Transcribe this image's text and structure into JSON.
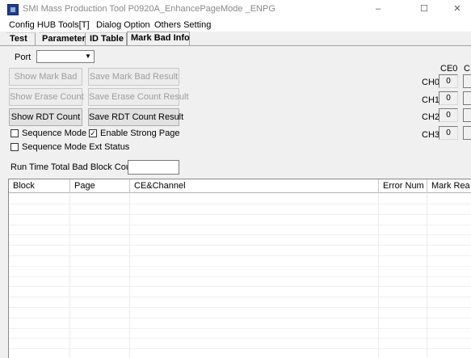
{
  "window": {
    "title": "SMI Mass Production Tool P0920A_EnhancePageMode       _ENPG",
    "minimize": "–",
    "maximize": "☐",
    "close": "✕"
  },
  "menubar": {
    "items": [
      "Config HUB",
      "Tools[T]",
      "Dialog Option",
      "Others Setting"
    ]
  },
  "tabs": [
    "Test",
    "Parameter",
    "ID Table",
    "Mark Bad Info"
  ],
  "active_tab": "Mark Bad Info",
  "port": {
    "label": "Port",
    "value": ""
  },
  "buttons": {
    "show_mark_bad": "Show Mark Bad",
    "save_mark_bad": "Save Mark Bad Result",
    "show_erase": "Show Erase Count",
    "save_erase": "Save Erase Count Result",
    "show_rdt": "Show RDT Count",
    "save_rdt": "Save RDT Count Result"
  },
  "checkboxes": {
    "sequence_mode": {
      "label": "Sequence Mode",
      "checked": false
    },
    "enable_strong_page": {
      "label": "Enable Strong Page",
      "checked": true
    },
    "sequence_mode_ext": {
      "label": "Sequence Mode Ext Status",
      "checked": false
    }
  },
  "run_time": {
    "label": "Run Time Total Bad Block Count",
    "value": ""
  },
  "ce_table": {
    "header": "CE0",
    "header_cut": "C",
    "rows": [
      {
        "label": "CH0",
        "value": "0"
      },
      {
        "label": "CH1",
        "value": "0"
      },
      {
        "label": "CH2",
        "value": "0"
      },
      {
        "label": "CH3",
        "value": "0"
      }
    ]
  },
  "grid": {
    "columns": [
      "Block",
      "Page",
      "CE&Channel",
      "Error Num",
      "Mark Rea"
    ]
  }
}
